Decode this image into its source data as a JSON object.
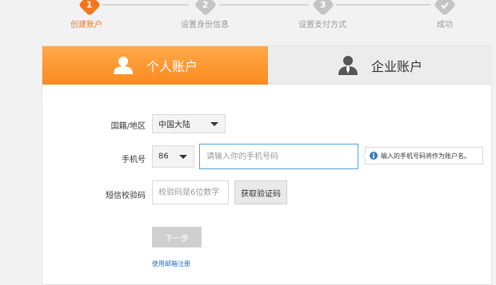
{
  "steps": [
    {
      "num": "1",
      "label": "创建账户",
      "state": "active"
    },
    {
      "num": "2",
      "label": "设置身份信息",
      "state": "todo"
    },
    {
      "num": "3",
      "label": "设置支付方式",
      "state": "todo"
    },
    {
      "num": "",
      "label": "成功",
      "state": "todo"
    }
  ],
  "tabs": {
    "personal": "个人账户",
    "enterprise": "企业账户"
  },
  "form": {
    "region_label": "国籍/地区",
    "region_value": "中国大陆",
    "phone_label": "手机号",
    "country_code": "86",
    "phone_placeholder": "请输入你的手机号码",
    "phone_tip": "输入的手机号码将作为账户名。",
    "sms_label": "短信校验码",
    "sms_placeholder": "校验码是6位数字",
    "get_code_button": "获取验证码",
    "next_button": "下一步",
    "email_register_link": "使用邮箱注册"
  },
  "colors": {
    "accent": "#f5761e",
    "tab_active_top": "#ffa94a",
    "tab_active_bottom": "#fb8a1e",
    "input_focus_border": "#4aa3df",
    "link": "#1a6fc4",
    "info_icon": "#3a79b8"
  },
  "icons": {
    "personal_tab": "person-icon",
    "enterprise_tab": "businessman-icon",
    "step_done": "checkmark-icon",
    "tip": "info-icon"
  }
}
